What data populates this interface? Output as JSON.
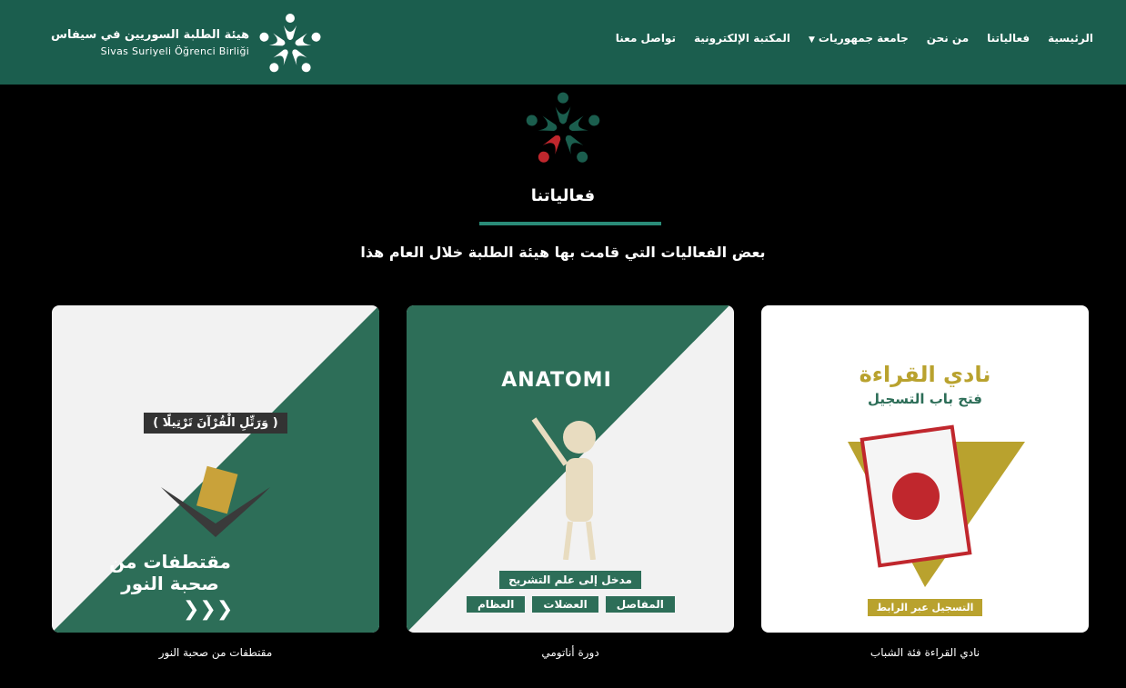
{
  "brand": {
    "name_ar": "هيئة الطلبة السوريين في سيفاس",
    "name_tr": "Sivas Suriyeli Öğrenci Birliği",
    "logo": "people-star-logo"
  },
  "nav": {
    "items": [
      {
        "label": "تواصل معنا"
      },
      {
        "label": "المكتبة الإلكترونية"
      },
      {
        "label": "جامعة جمهوريات",
        "dropdown": true
      },
      {
        "label": "من نحن"
      },
      {
        "label": "فعالياتنا"
      },
      {
        "label": "الرئيسية"
      }
    ]
  },
  "colors": {
    "primary": "#1b5e4e",
    "accent": "#2a8c78",
    "gold": "#b9a22e",
    "red": "#c0272d"
  },
  "section": {
    "title": "فعالياتنا",
    "subtitle": "بعض الفعاليات التي قامت بها هيئة الطلبة خلال العام هذا"
  },
  "cards": [
    {
      "caption": "نادي القراءة فئة الشباب",
      "image_title": "نادي القراءة",
      "image_sub": "فتح باب التسجيل",
      "image_button": "التسجيل عبر الرابط"
    },
    {
      "caption": "دورة أناتومي",
      "image_title": "ANATOMI",
      "image_sub": "مدخل إلى علم التشريح",
      "image_tags": [
        "العظام",
        "العضلات",
        "المفاصل"
      ]
    },
    {
      "caption": "مقتطفات من صحبة النور",
      "image_title": "مقتطفات من صحبة النور",
      "image_sub": "( وَرَتِّلِ الْقُرْآنَ تَرْتِيلًا )"
    }
  ]
}
